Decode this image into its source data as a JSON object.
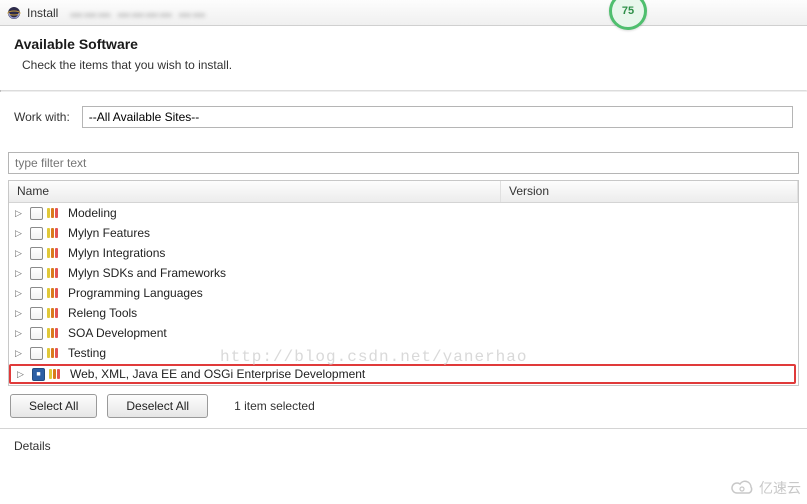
{
  "titlebar": {
    "title": "Install"
  },
  "progress": {
    "value": "75"
  },
  "header": {
    "heading": "Available Software",
    "subtext": "Check the items that you wish to install."
  },
  "workwith": {
    "label": "Work with:",
    "value": "--All Available Sites--"
  },
  "filter": {
    "placeholder": "type filter text"
  },
  "columns": {
    "name": "Name",
    "version": "Version"
  },
  "items": [
    {
      "label": "Modeling",
      "checked": false
    },
    {
      "label": "Mylyn Features",
      "checked": false
    },
    {
      "label": "Mylyn Integrations",
      "checked": false
    },
    {
      "label": "Mylyn SDKs and Frameworks",
      "checked": false
    },
    {
      "label": "Programming Languages",
      "checked": false
    },
    {
      "label": "Releng Tools",
      "checked": false
    },
    {
      "label": "SOA Development",
      "checked": false
    },
    {
      "label": "Testing",
      "checked": false
    },
    {
      "label": "Web, XML, Java EE and OSGi Enterprise Development",
      "checked": true
    }
  ],
  "buttons": {
    "select_all": "Select All",
    "deselect_all": "Deselect All"
  },
  "status": "1 item selected",
  "details": {
    "label": "Details"
  },
  "watermarks": {
    "url_text": "http://blog.csdn.net/yanerhao",
    "brand": "亿速云"
  }
}
